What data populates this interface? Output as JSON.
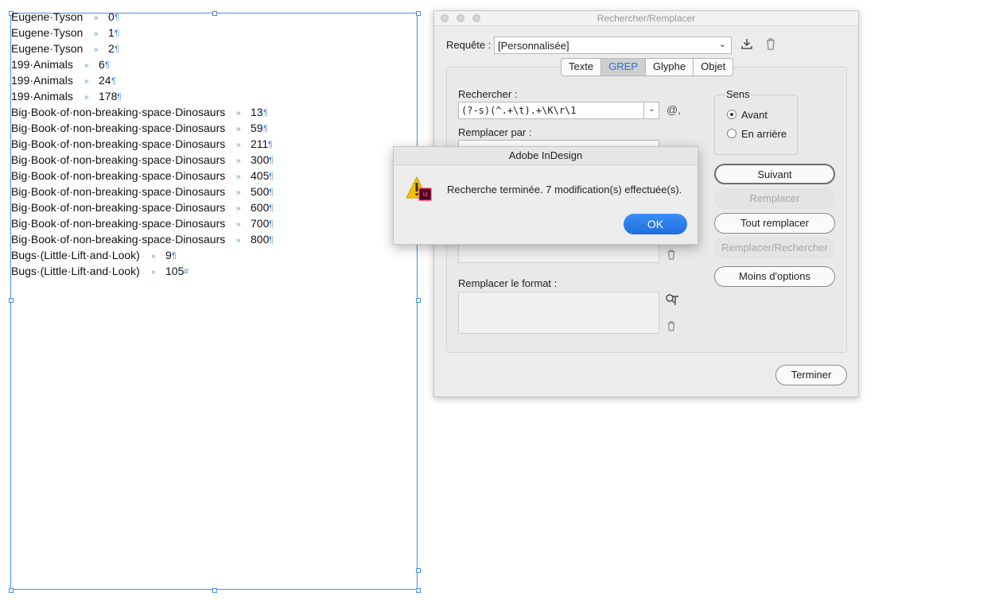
{
  "document": {
    "lines": [
      {
        "name": "Eugene·Tyson",
        "value": "0",
        "end": "¶"
      },
      {
        "name": "Eugene·Tyson",
        "value": "1",
        "end": "¶"
      },
      {
        "name": "Eugene·Tyson",
        "value": "2",
        "end": "¶"
      },
      {
        "name": "199·Animals",
        "value": "6",
        "end": "¶"
      },
      {
        "name": "199·Animals",
        "value": "24",
        "end": "¶"
      },
      {
        "name": "199·Animals",
        "value": "178",
        "end": "¶"
      },
      {
        "name": "Big·Book·of·non-breaking·space·Dinosaurs",
        "value": "13",
        "end": "¶"
      },
      {
        "name": "Big·Book·of·non-breaking·space·Dinosaurs",
        "value": "59",
        "end": "¶"
      },
      {
        "name": "Big·Book·of·non-breaking·space·Dinosaurs",
        "value": "211",
        "end": "¶"
      },
      {
        "name": "Big·Book·of·non-breaking·space·Dinosaurs",
        "value": "300",
        "end": "¶"
      },
      {
        "name": "Big·Book·of·non-breaking·space·Dinosaurs",
        "value": "405",
        "end": "¶"
      },
      {
        "name": "Big·Book·of·non-breaking·space·Dinosaurs",
        "value": "500",
        "end": "¶"
      },
      {
        "name": "Big·Book·of·non-breaking·space·Dinosaurs",
        "value": "600",
        "end": "¶"
      },
      {
        "name": "Big·Book·of·non-breaking·space·Dinosaurs",
        "value": "700",
        "end": "¶"
      },
      {
        "name": "Big·Book·of·non-breaking·space·Dinosaurs",
        "value": "800",
        "end": "¶"
      },
      {
        "name": "Bugs·(Little·Lift·and·Look)",
        "value": "9",
        "end": "¶"
      },
      {
        "name": "Bugs·(Little·Lift·and·Look)",
        "value": "105",
        "end": "#"
      }
    ],
    "tab_glyph": "»"
  },
  "panel": {
    "title": "Rechercher/Remplacer",
    "query_label": "Requête :",
    "query_value": "[Personnalisée]",
    "tabs": [
      {
        "label": "Texte",
        "active": false
      },
      {
        "label": "GREP",
        "active": true
      },
      {
        "label": "Glyphe",
        "active": false
      },
      {
        "label": "Objet",
        "active": false
      }
    ],
    "find_label": "Rechercher :",
    "find_value": "(?-s)(^.+\\t).+\\K\\r\\1",
    "replace_label": "Remplacer par :",
    "replace_format_label": "Remplacer le format :",
    "direction_label": "Sens",
    "direction_forward": "Avant",
    "direction_backward": "En arrière",
    "buttons": {
      "next": "Suivant",
      "replace": "Remplacer",
      "replace_all": "Tout remplacer",
      "replace_find": "Remplacer/Rechercher",
      "fewer_options": "Moins d'options",
      "done": "Terminer"
    },
    "special_char_glyph": "@,"
  },
  "alert": {
    "title": "Adobe InDesign",
    "message": "Recherche terminée.  7 modification(s) effectuée(s).",
    "ok_label": "OK",
    "app_badge": "Id"
  },
  "colors": {
    "accent": "#1f6ee0",
    "frame": "#4a90e2",
    "warning": "#f2c200"
  }
}
